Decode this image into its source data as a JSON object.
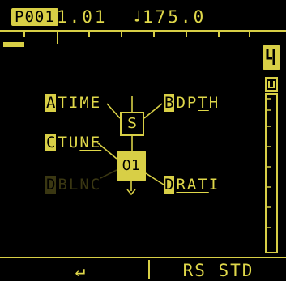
{
  "header": {
    "preset": "P001",
    "position": "1.01",
    "tempo_icon": "note-icon",
    "tempo": "175.0"
  },
  "sidebar": {
    "top_icon": "effect-block-icon",
    "meter_label": "U",
    "level_fraction": 0.0
  },
  "routing": {
    "a": {
      "key": "A",
      "label_pre": "TIME",
      "label_ul": ""
    },
    "b": {
      "key": "B",
      "label_pre": "DP",
      "label_ul": "T",
      "label_post": "H"
    },
    "c": {
      "key": "C",
      "label_pre": "TU",
      "label_ul": "NE",
      "label_post": ""
    },
    "dim": {
      "key": "D",
      "label_pre": "BLNC"
    },
    "d": {
      "key": "D",
      "label_pre": "",
      "label_ul": "RAT",
      "label_post": "I"
    },
    "s_box": "S",
    "o_box": "01"
  },
  "footer": {
    "left_icon": "return-arrow-icon",
    "left_glyph": "↵",
    "right_label": "RS STD"
  },
  "colors": {
    "accent": "#d8cf46",
    "dim": "#3a3712",
    "background": "#000000"
  }
}
